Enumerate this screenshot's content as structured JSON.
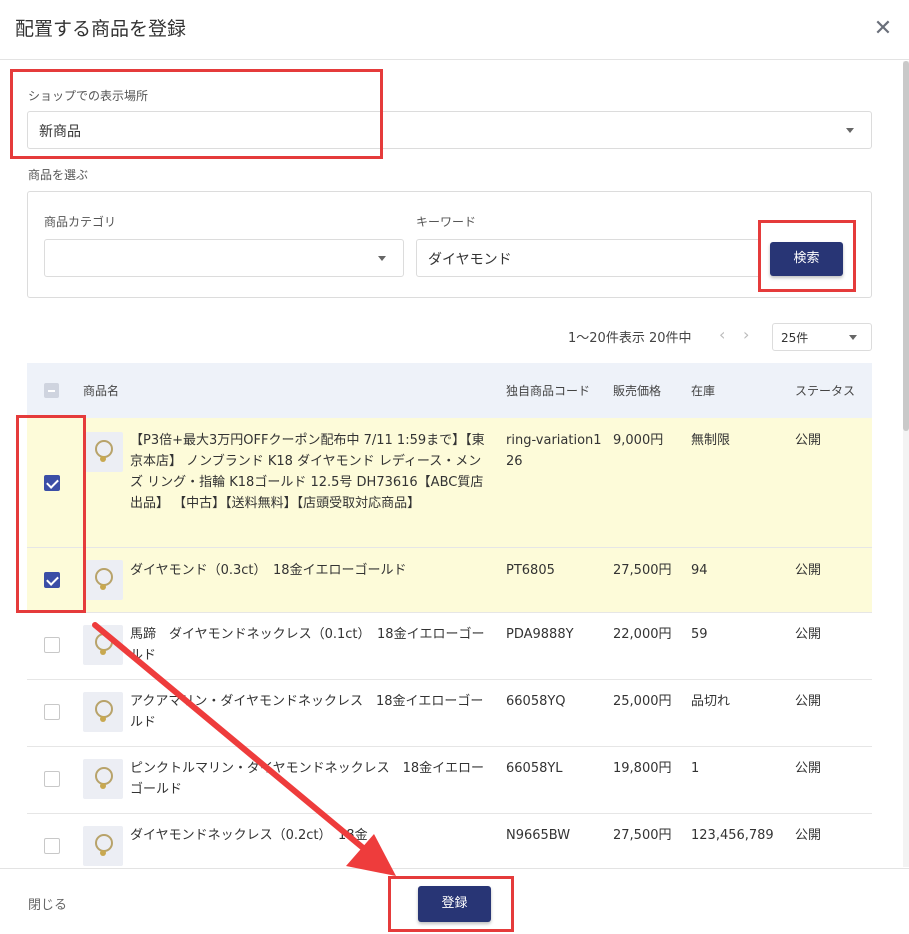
{
  "modal": {
    "title": "配置する商品を登録",
    "close_symbol": "✕"
  },
  "display_location": {
    "label": "ショップでの表示場所",
    "value": "新商品"
  },
  "product_select": {
    "label": "商品を選ぶ",
    "category_label": "商品カテゴリ",
    "category_value": "",
    "keyword_label": "キーワード",
    "keyword_value": "ダイヤモンド",
    "search_button": "検索"
  },
  "pager": {
    "summary": "1〜20件表示 20件中",
    "prev": "‹",
    "next": "›",
    "per_page": "25件"
  },
  "table": {
    "headers": {
      "name": "商品名",
      "code": "独自商品コード",
      "price": "販売価格",
      "stock": "在庫",
      "status": "ステータス"
    },
    "rows": [
      {
        "checked": true,
        "name": "【P3倍+最大3万円OFFクーポン配布中 7/11 1:59まで】【東京本店】 ノンブランド K18 ダイヤモンド レディース・メンズ リング・指輪 K18ゴールド 12.5号 DH73616【ABC質店出品】 【中古】【送料無料】【店頭受取対応商品】",
        "code": "ring-variation126",
        "price": "9,000円",
        "stock": "無制限",
        "status": "公開"
      },
      {
        "checked": true,
        "name": "ダイヤモンド（0.3ct）　18金イエローゴールド",
        "code": "PT6805",
        "price": "27,500円",
        "stock": "94",
        "status": "公開"
      },
      {
        "checked": false,
        "name": "馬蹄　ダイヤモンドネックレス（0.1ct）　18金イエローゴールド",
        "code": "PDA9888Y",
        "price": "22,000円",
        "stock": "59",
        "status": "公開"
      },
      {
        "checked": false,
        "name": "アクアマリン・ダイヤモンドネックレス　18金イエローゴールド",
        "code": "66058YQ",
        "price": "25,000円",
        "stock": "品切れ",
        "status": "公開"
      },
      {
        "checked": false,
        "name": "ピンクトルマリン・ダイヤモンドネックレス　18金イエローゴールド",
        "code": "66058YL",
        "price": "19,800円",
        "stock": "1",
        "status": "公開"
      },
      {
        "checked": false,
        "name": "ダイヤモンドネックレス（0.2ct）　18金",
        "code": "N9665BW",
        "price": "27,500円",
        "stock": "123,456,789",
        "status": "公開"
      }
    ]
  },
  "footer": {
    "close_label": "閉じる",
    "submit_label": "登録"
  },
  "colors": {
    "primary": "#283575",
    "highlight": "#e53b3b",
    "selected_row": "#fdfbd9",
    "header_bg": "#eef2f9"
  }
}
